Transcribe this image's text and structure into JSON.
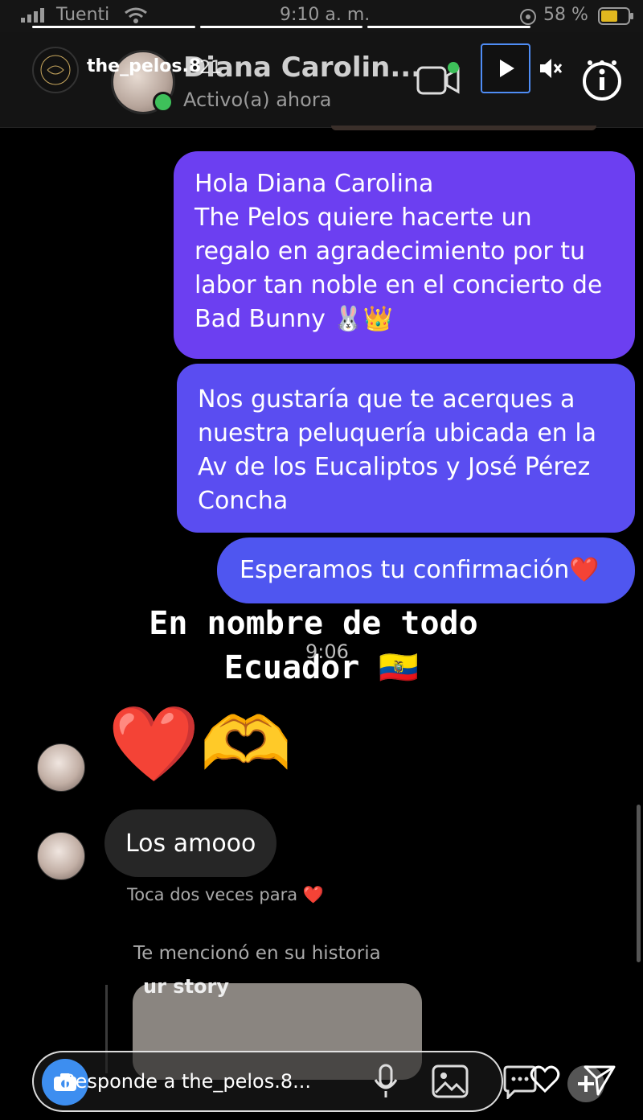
{
  "status_bar": {
    "carrier": "Tuenti",
    "time": "9:10 a. m.",
    "battery": "58 %"
  },
  "story": {
    "username": "the_pelos.8",
    "time_ago": "21"
  },
  "chat_header": {
    "contact_name": "Diana Carolin...",
    "activity": "Activo(a) ahora"
  },
  "messages": {
    "outgoing": [
      {
        "lines": [
          "Hola Diana Carolina",
          "The Pelos quiere hacerte un",
          "regalo en agradecimiento por tu",
          "labor tan noble en el concierto de",
          "Bad Bunny 🐰👑"
        ]
      },
      {
        "lines": [
          "Nos gustaría que te acerques a",
          "nuestra peluquería ubicada en la",
          "Av de los Eucaliptos y José Pérez",
          "Concha"
        ]
      },
      {
        "lines": [
          "Esperamos tu confirmación❤️"
        ]
      }
    ],
    "timestamp": "9:06",
    "incoming_emoji": "❤️🫶",
    "incoming_text": "Los amooo",
    "double_tap_hint": "Toca dos veces para ❤️",
    "mention_notice": "Te mencionó en su historia",
    "story_card_label": "ur story"
  },
  "overlay": {
    "line1": "En nombre de todo",
    "line2": "Ecuador 🇪🇨"
  },
  "reply_bar": {
    "placeholder": "Responde a the_pelos.8..."
  },
  "icons": [
    "signal-icon",
    "wifi-icon",
    "battery-icon",
    "video-call-icon",
    "play-icon",
    "mute-icon",
    "info-icon",
    "camera-icon",
    "mic-icon",
    "gallery-icon",
    "sticker-icon",
    "heart-icon",
    "send-icon",
    "plus-icon"
  ],
  "colors": {
    "bubble_primary": "#6c3ff1",
    "bubble_secondary": "#5a4df1",
    "bubble_tertiary": "#4f56f0",
    "incoming_bubble": "#262626",
    "online": "#3ec05a"
  }
}
